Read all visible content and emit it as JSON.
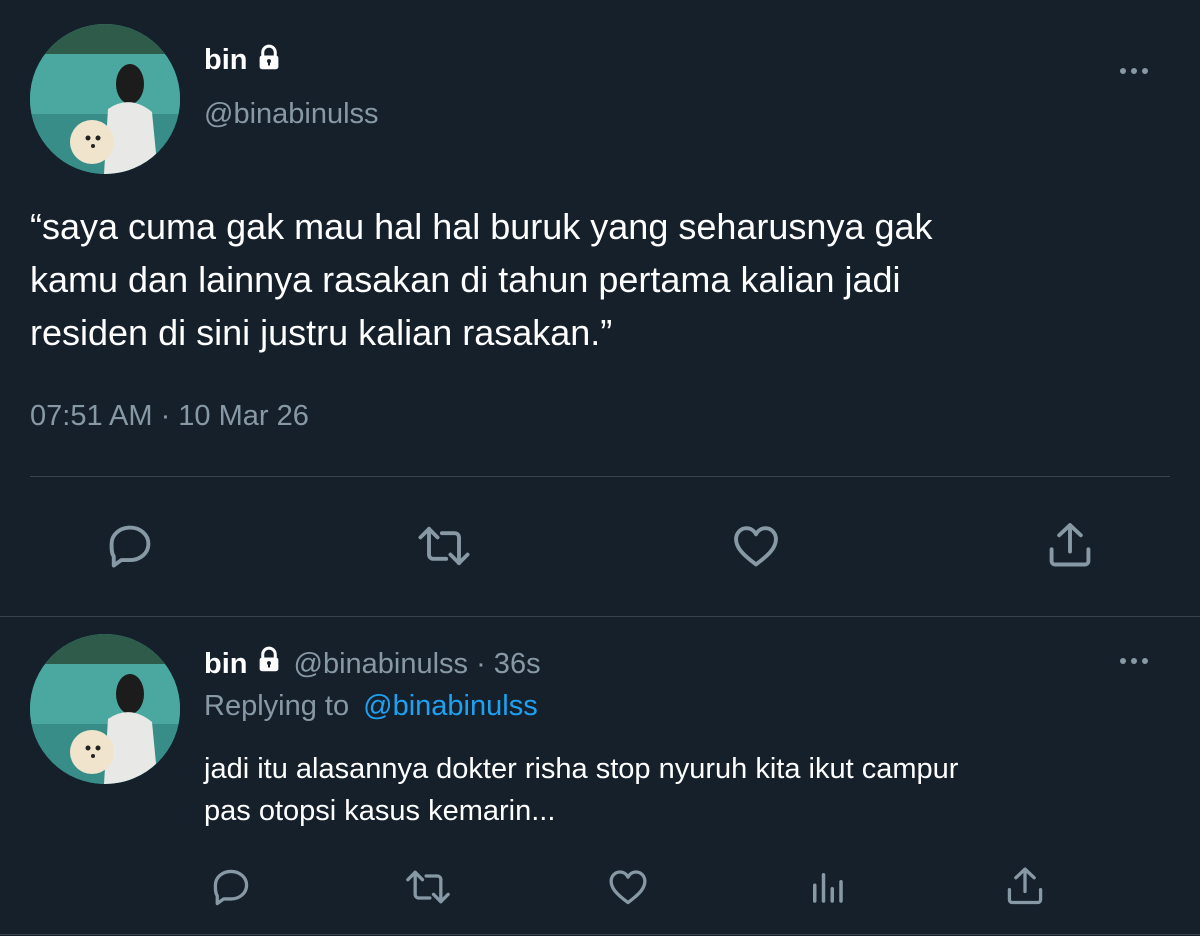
{
  "main_tweet": {
    "display_name": "bin",
    "handle": "@binabinulss",
    "text_lines": [
      "“saya cuma gak mau hal hal buruk yang seharusnya gak",
      "kamu dan lainnya rasakan di tahun pertama kalian jadi",
      "residen di sini justru kalian rasakan.”"
    ],
    "timestamp": "07:51 AM · 10 Mar 26",
    "icons": [
      "lock-icon",
      "more-icon",
      "reply-icon",
      "retweet-icon",
      "like-icon",
      "share-icon"
    ]
  },
  "reply_tweet": {
    "display_name": "bin",
    "handle_time": "@binabinulss · 36s",
    "replying_label": "Replying to",
    "replying_handle": "@binabinulss",
    "text_lines": [
      "jadi itu alasannya dokter risha stop nyuruh kita ikut campur",
      "pas otopsi kasus kemarin..."
    ],
    "icons": [
      "lock-icon",
      "more-icon",
      "reply-icon",
      "retweet-icon",
      "like-icon",
      "analytics-icon",
      "share-icon"
    ]
  },
  "colors": {
    "background": "#15202b",
    "text": "#ffffff",
    "muted": "#8899a6",
    "link": "#1da1f2",
    "divider": "#38444d"
  }
}
